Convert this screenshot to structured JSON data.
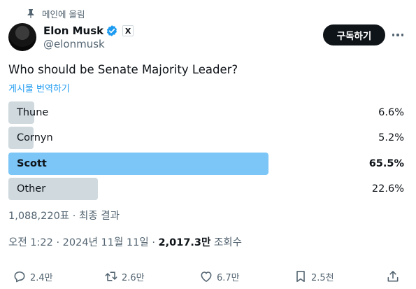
{
  "pinned": {
    "label": "메인에 올림",
    "icon": "pin-icon"
  },
  "author": {
    "name": "Elon Musk",
    "handle": "@elonmusk",
    "verified_icon": "verified-badge-icon",
    "affiliate_icon": "x-logo-icon",
    "affiliate_text": "X",
    "verified_color": "#1d9bf0"
  },
  "subscribe_label": "구독하기",
  "more_icon": "more-icon",
  "post": {
    "question": "Who should be Senate Majority Leader?",
    "translate_label": "게시물 번역하기"
  },
  "poll": {
    "options": [
      {
        "label": "Thune",
        "percent": "6.6%",
        "value": 6.6,
        "winner": false
      },
      {
        "label": "Cornyn",
        "percent": "5.2%",
        "value": 5.2,
        "winner": false
      },
      {
        "label": "Scott",
        "percent": "65.5%",
        "value": 65.5,
        "winner": true
      },
      {
        "label": "Other",
        "percent": "22.6%",
        "value": 22.6,
        "winner": false
      }
    ],
    "votes_text": "1,088,220표 · 최종 결과"
  },
  "meta": {
    "timestamp": "오전 1:22 · 2024년 11월 11일 · ",
    "views_count": "2,017.3만",
    "views_label": " 조회수"
  },
  "actions": {
    "reply": {
      "icon": "reply-icon",
      "count": "2.4만"
    },
    "repost": {
      "icon": "repost-icon",
      "count": "2.6만"
    },
    "like": {
      "icon": "heart-icon",
      "count": "6.7만"
    },
    "bookmark": {
      "icon": "bookmark-icon",
      "count": "2.5천"
    },
    "share": {
      "icon": "share-icon"
    }
  },
  "colors": {
    "accent": "#1d9bf0",
    "poll_bar": "#cfd9de",
    "poll_bar_winner": "#7cc6f7",
    "secondary_text": "#536471"
  }
}
